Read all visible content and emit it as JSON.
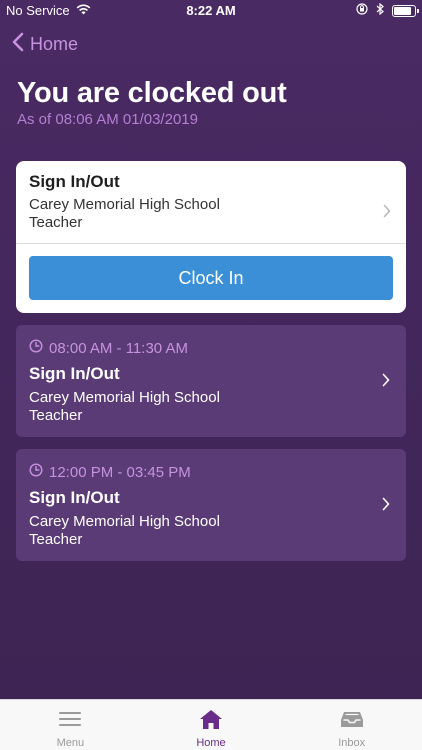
{
  "status_bar": {
    "carrier": "No Service",
    "time": "8:22 AM",
    "battery_level": 0.9
  },
  "nav": {
    "back_label": "Home"
  },
  "header": {
    "title": "You are clocked out",
    "subtitle": "As of 08:06 AM 01/03/2019"
  },
  "main_card": {
    "title": "Sign In/Out",
    "location": "Carey Memorial High School",
    "role": "Teacher",
    "clock_in_label": "Clock In"
  },
  "shifts": [
    {
      "time": "08:00 AM - 11:30 AM",
      "title": "Sign In/Out",
      "location": "Carey Memorial High School",
      "role": "Teacher"
    },
    {
      "time": "12:00 PM - 03:45 PM",
      "title": "Sign In/Out",
      "location": "Carey Memorial High School",
      "role": "Teacher"
    }
  ],
  "tab_bar": {
    "tabs": [
      {
        "label": "Menu",
        "icon": "menu-icon",
        "active": false
      },
      {
        "label": "Home",
        "icon": "home-icon",
        "active": true
      },
      {
        "label": "Inbox",
        "icon": "inbox-icon",
        "active": false
      }
    ]
  },
  "colors": {
    "background": "#45285e",
    "accent": "#c792e0",
    "button": "#3a8fd6",
    "active_tab": "#6a2c8a"
  }
}
